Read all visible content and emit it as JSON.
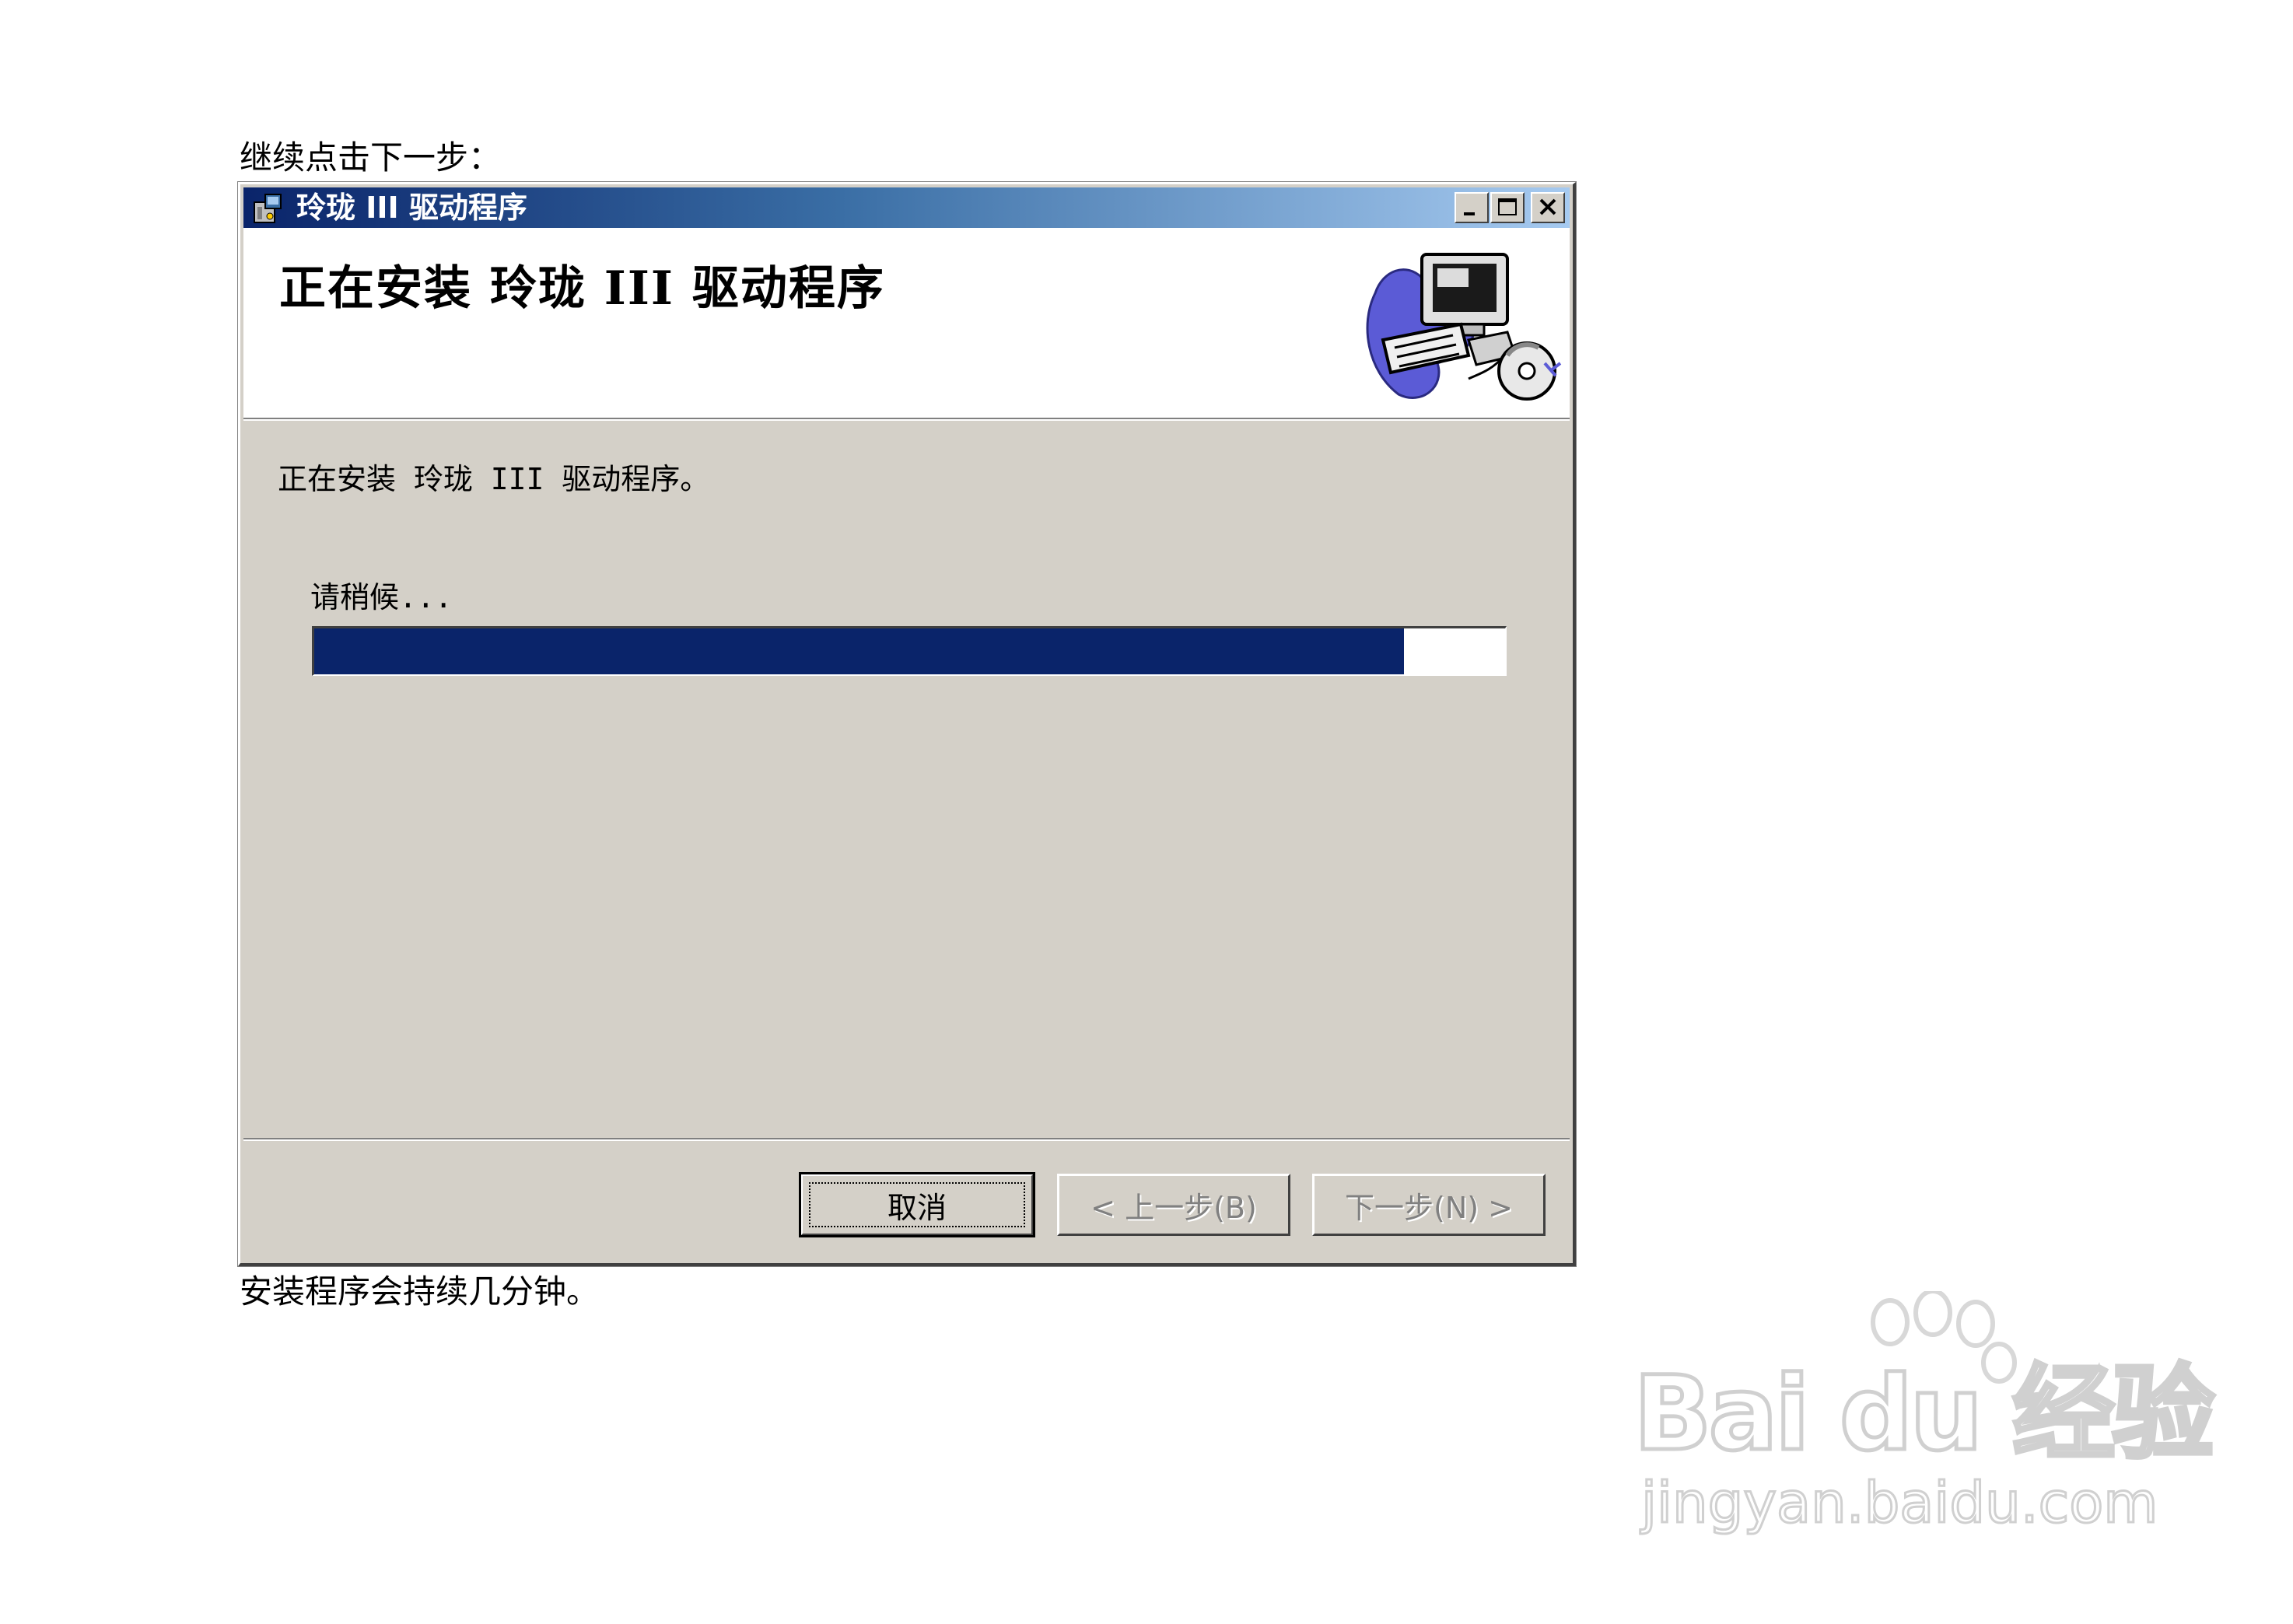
{
  "document": {
    "intro_text": "继续点击下一步：",
    "outro_text": "安装程序会持续几分钟。"
  },
  "window": {
    "title": "玲珑 III 驱动程序",
    "banner_title": "正在安装 玲珑 III 驱动程序",
    "status_text": "正在安装 玲珑 III 驱动程序。",
    "wait_text": "请稍候...",
    "progress_fraction": 0.915,
    "progress_color": "#0a246a",
    "buttons": {
      "cancel": "取消",
      "back": "< 上一步(B)",
      "next": "下一步(N) >"
    },
    "icons": {
      "title": "installer-icon",
      "banner": "computer-cd-illustration",
      "minimize": "minimize-icon",
      "maximize": "maximize-icon",
      "close": "close-icon"
    }
  },
  "watermark": {
    "logo": "Bai du 经验",
    "url": "jingyan.baidu.com"
  }
}
